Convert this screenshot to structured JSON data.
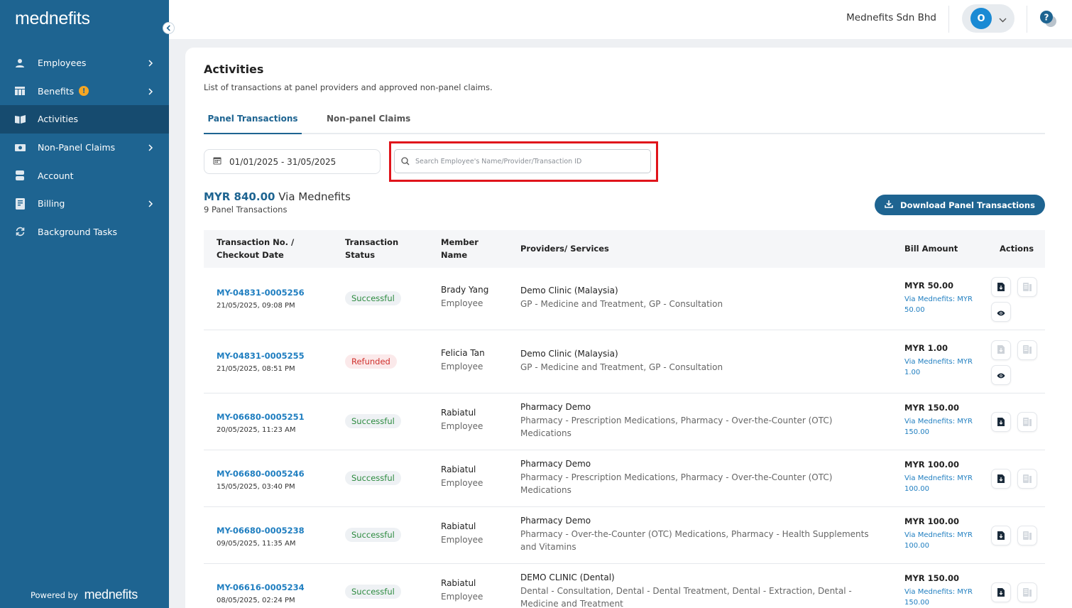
{
  "brand": {
    "logo_text": "mednefits",
    "powered_by": "Powered by",
    "powered_brand": "mednefits"
  },
  "sidebar": {
    "items": [
      {
        "label": "Employees",
        "icon": "person-icon",
        "chevron": true,
        "badge": ""
      },
      {
        "label": "Benefits",
        "icon": "benefits-icon",
        "chevron": true,
        "badge": "!"
      },
      {
        "label": "Activities",
        "icon": "book-icon",
        "chevron": false,
        "badge": "",
        "active": true
      },
      {
        "label": "Non-Panel Claims",
        "icon": "cash-icon",
        "chevron": true,
        "badge": ""
      },
      {
        "label": "Account",
        "icon": "account-icon",
        "chevron": false,
        "badge": ""
      },
      {
        "label": "Billing",
        "icon": "invoice-icon",
        "chevron": true,
        "badge": ""
      },
      {
        "label": "Background Tasks",
        "icon": "refresh-icon",
        "chevron": false,
        "badge": ""
      }
    ]
  },
  "topbar": {
    "company": "Mednefits Sdn Bhd",
    "avatar_initial": "O",
    "help_label": "?"
  },
  "page": {
    "title": "Activities",
    "subtitle": "List of transactions at panel providers and approved non-panel claims.",
    "tabs": [
      "Panel Transactions",
      "Non-panel Claims"
    ],
    "date_range": "01/01/2025 - 31/05/2025",
    "search_placeholder": "Search Employee's Name/Provider/Transaction ID",
    "total_amount": "MYR 840.00",
    "total_suffix": " Via Mednefits",
    "count": "9 Panel Transactions",
    "download_label": "Download Panel Transactions"
  },
  "table": {
    "headers": {
      "txn": [
        "Transaction No. /",
        "Checkout Date"
      ],
      "status": [
        "Transaction",
        "Status"
      ],
      "member": [
        "Member",
        "Name"
      ],
      "provider": "Providers/ Services",
      "bill": "Bill Amount",
      "actions": "Actions"
    },
    "rows": [
      {
        "txn": "MY-04831-0005256",
        "date": "21/05/2025, 09:08 PM",
        "status": "Successful",
        "status_type": "success",
        "member": "Brady Yang",
        "member_type": "Employee",
        "provider": "Demo Clinic (Malaysia)",
        "services": "GP - Medicine and Treatment, GP - Consultation",
        "bill": "MYR 50.00",
        "via": "Via Mednefits: MYR 50.00",
        "receipt_enabled": true,
        "view": true
      },
      {
        "txn": "MY-04831-0005255",
        "date": "21/05/2025, 08:51 PM",
        "status": "Refunded",
        "status_type": "refund",
        "member": "Felicia Tan",
        "member_type": "Employee",
        "provider": "Demo Clinic (Malaysia)",
        "services": "GP - Medicine and Treatment, GP - Consultation",
        "bill": "MYR 1.00",
        "via": "Via Mednefits: MYR 1.00",
        "receipt_enabled": false,
        "view": true
      },
      {
        "txn": "MY-06680-0005251",
        "date": "20/05/2025, 11:23 AM",
        "status": "Successful",
        "status_type": "success",
        "member": "Rabiatul",
        "member_type": "Employee",
        "provider": "Pharmacy Demo",
        "services": "Pharmacy - Prescription Medications, Pharmacy - Over-the-Counter (OTC) Medications",
        "bill": "MYR 150.00",
        "via": "Via Mednefits: MYR 150.00",
        "receipt_enabled": true,
        "view": false
      },
      {
        "txn": "MY-06680-0005246",
        "date": "15/05/2025, 03:40 PM",
        "status": "Successful",
        "status_type": "success",
        "member": "Rabiatul",
        "member_type": "Employee",
        "provider": "Pharmacy Demo",
        "services": "Pharmacy - Prescription Medications, Pharmacy - Over-the-Counter (OTC) Medications",
        "bill": "MYR 100.00",
        "via": "Via Mednefits: MYR 100.00",
        "receipt_enabled": true,
        "view": false
      },
      {
        "txn": "MY-06680-0005238",
        "date": "09/05/2025, 11:35 AM",
        "status": "Successful",
        "status_type": "success",
        "member": "Rabiatul",
        "member_type": "Employee",
        "provider": "Pharmacy Demo",
        "services": "Pharmacy - Over-the-Counter (OTC) Medications, Pharmacy - Health Supplements and Vitamins",
        "bill": "MYR 100.00",
        "via": "Via Mednefits: MYR 100.00",
        "receipt_enabled": true,
        "view": false
      },
      {
        "txn": "MY-06616-0005234",
        "date": "08/05/2025, 02:24 PM",
        "status": "Successful",
        "status_type": "success",
        "member": "Rabiatul",
        "member_type": "Employee",
        "provider": "DEMO CLINIC (Dental)",
        "services": "Dental - Consultation, Dental - Dental Treatment, Dental - Extraction, Dental - Medicine and Treatment",
        "bill": "MYR 150.00",
        "via": "Via Mednefits: MYR 150.00",
        "receipt_enabled": true,
        "view": false
      }
    ]
  },
  "colors": {
    "sidebar": "#1e6491",
    "sidebar_active": "#164b6f",
    "accent_link": "#1f7ec0",
    "success": "#2b8a3e",
    "refund": "#d0312d",
    "highlight": "#e0141b"
  }
}
